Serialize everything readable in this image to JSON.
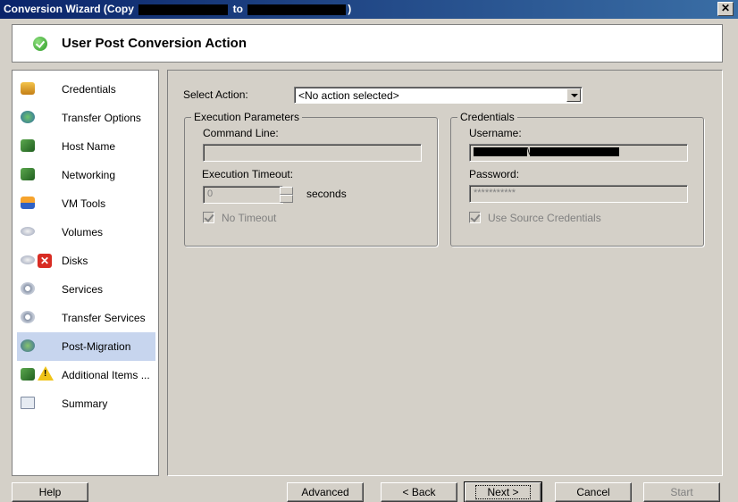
{
  "window": {
    "title_start": "Conversion Wizard (Copy ",
    "title_mid": " to ",
    "title_end": ")",
    "close": "✕"
  },
  "header": {
    "title": "User Post Conversion Action"
  },
  "sidebar": {
    "items": [
      {
        "label": "Credentials"
      },
      {
        "label": "Transfer Options"
      },
      {
        "label": "Host Name"
      },
      {
        "label": "Networking"
      },
      {
        "label": "VM Tools"
      },
      {
        "label": "Volumes"
      },
      {
        "label": "Disks"
      },
      {
        "label": "Services"
      },
      {
        "label": "Transfer Services"
      },
      {
        "label": "Post-Migration"
      },
      {
        "label": "Additional Items ..."
      },
      {
        "label": "Summary"
      }
    ],
    "active": "Post-Migration"
  },
  "main": {
    "select_action_label": "Select Action:",
    "select_action_value": "<No action selected>",
    "execution": {
      "legend": "Execution Parameters",
      "command_line_label": "Command Line:",
      "command_line_value": "",
      "timeout_label": "Execution Timeout:",
      "timeout_value": "0",
      "timeout_unit": "seconds",
      "no_timeout_label": "No Timeout",
      "no_timeout_checked": true
    },
    "credentials": {
      "legend": "Credentials",
      "username_label": "Username:",
      "password_label": "Password:",
      "password_value": "***********",
      "use_source_label": "Use Source Credentials",
      "use_source_checked": true
    }
  },
  "footer": {
    "help": "Help",
    "advanced": "Advanced",
    "back": "< Back",
    "next": "Next >",
    "cancel": "Cancel",
    "start": "Start"
  }
}
